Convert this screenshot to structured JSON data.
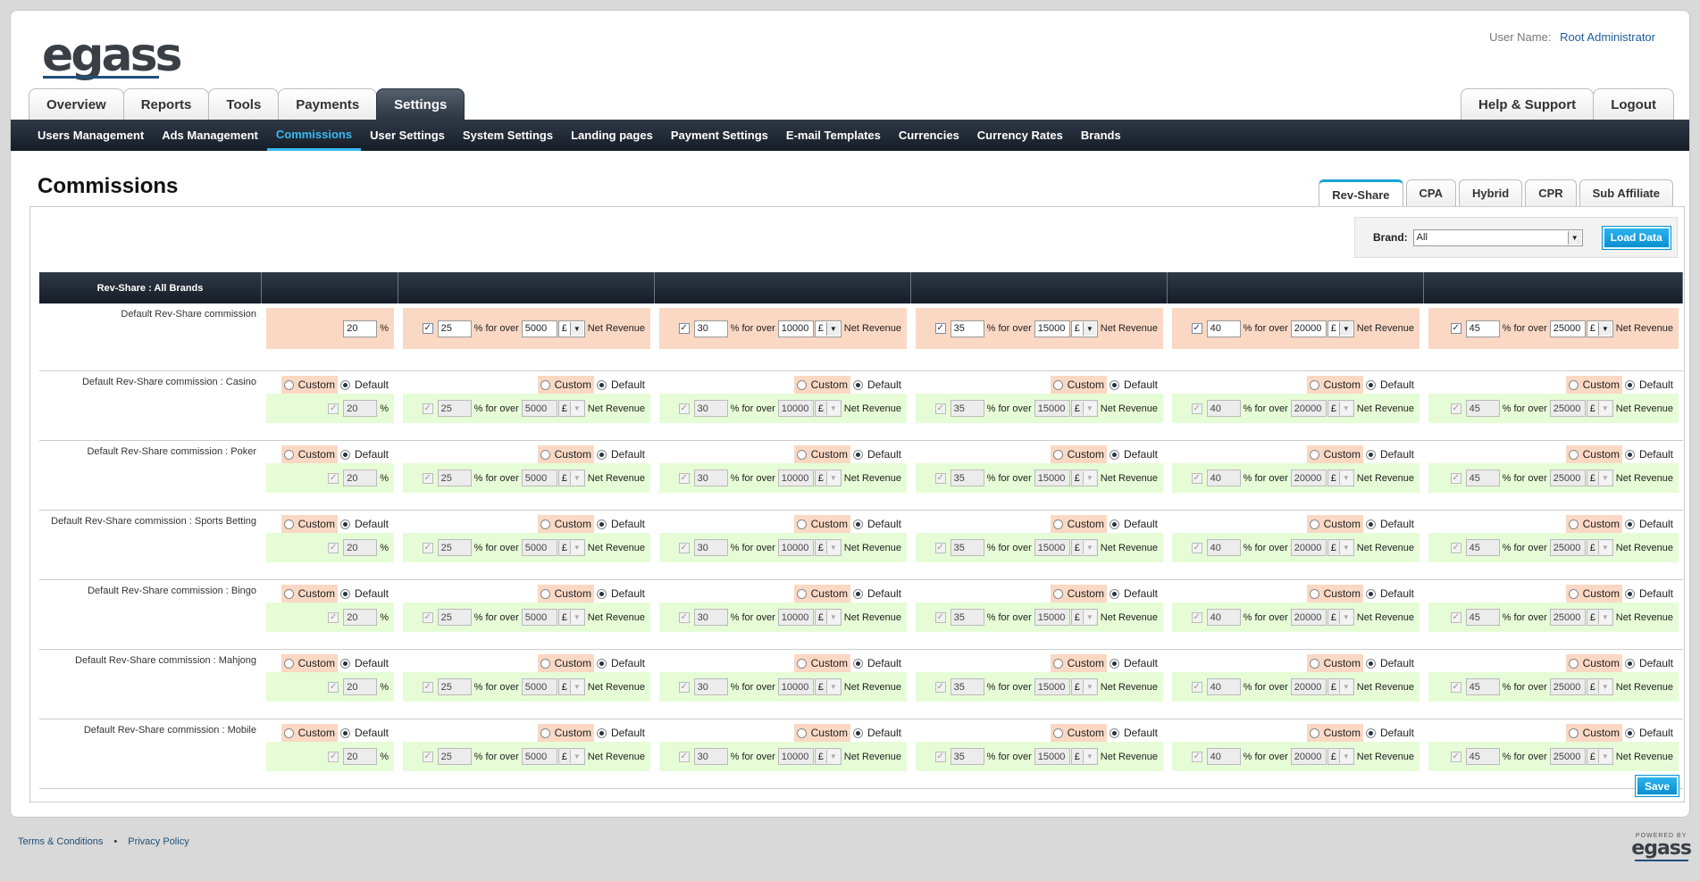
{
  "logo": "egass",
  "user": {
    "label": "User Name:",
    "name": "Root Administrator"
  },
  "main_tabs": [
    "Overview",
    "Reports",
    "Tools",
    "Payments",
    "Settings"
  ],
  "right_tabs": [
    "Help & Support",
    "Logout"
  ],
  "subnav": [
    "Users Management",
    "Ads Management",
    "Commissions",
    "User Settings",
    "System Settings",
    "Landing pages",
    "Payment Settings",
    "E-mail Templates",
    "Currencies",
    "Currency Rates",
    "Brands"
  ],
  "page_title": "Commissions",
  "commission_tabs": [
    "Rev-Share",
    "CPA",
    "Hybrid",
    "CPR",
    "Sub Affiliate"
  ],
  "brand": {
    "label": "Brand:",
    "value": "All",
    "load_label": "Load Data"
  },
  "table": {
    "header": "Rev-Share : All Brands",
    "base_value": "20",
    "percent": "%",
    "for_over": "% for over",
    "net_revenue": "Net Revenue",
    "currency": "£",
    "tiers": [
      {
        "pct": "25",
        "amount": "5000"
      },
      {
        "pct": "30",
        "amount": "10000"
      },
      {
        "pct": "35",
        "amount": "15000"
      },
      {
        "pct": "40",
        "amount": "20000"
      },
      {
        "pct": "45",
        "amount": "25000"
      }
    ],
    "custom_label": "Custom",
    "default_label": "Default",
    "rows": [
      "Default Rev-Share commission",
      "Default Rev-Share commission : Casino",
      "Default Rev-Share commission : Poker",
      "Default Rev-Share commission : Sports Betting",
      "Default Rev-Share commission : Bingo",
      "Default Rev-Share commission : Mahjong",
      "Default Rev-Share commission : Mobile"
    ]
  },
  "save_label": "Save",
  "footer": {
    "terms": "Terms & Conditions",
    "privacy": "Privacy Policy",
    "separator": "•"
  },
  "powered": {
    "line1": "POWERED BY",
    "line2": "egass"
  }
}
